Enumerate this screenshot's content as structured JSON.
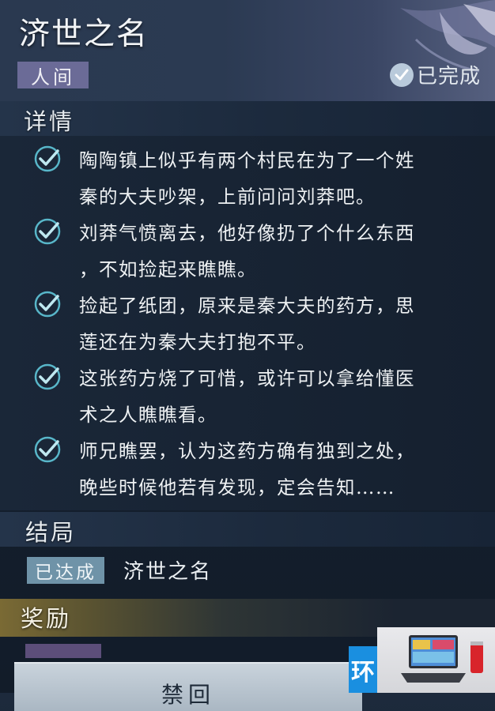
{
  "header": {
    "title": "济世之名",
    "category": "人间",
    "status": "已完成"
  },
  "details": {
    "heading": "详情",
    "steps": [
      {
        "line1": "陶陶镇上似乎有两个村民在为了一个姓",
        "line2": "秦的大夫吵架，上前问问刘莽吧。"
      },
      {
        "line1": "刘莽气愤离去，他好像扔了个什么东西",
        "line2": "，不如捡起来瞧瞧。"
      },
      {
        "line1": "捡起了纸团，原来是秦大夫的药方，思",
        "line2": "莲还在为秦大夫打抱不平。"
      },
      {
        "line1": "这张药方烧了可惜，或许可以拿给懂医",
        "line2": "术之人瞧瞧看。"
      },
      {
        "line1": "师兄瞧罢，认为这药方确有独到之处，",
        "line2": "晚些时候他若有发现，定会告知……"
      }
    ]
  },
  "ending": {
    "heading": "结局",
    "badge": "已达成",
    "name": "济世之名"
  },
  "reward": {
    "heading": "奖励"
  },
  "return_button": {
    "label": "禁回"
  },
  "watermark": {
    "text": "环"
  },
  "colors": {
    "check_stroke": "#bfe8f0",
    "check_glow": "#5fc7d9",
    "category_badge": "#6b6b97",
    "ending_badge": "#6f93a8"
  }
}
